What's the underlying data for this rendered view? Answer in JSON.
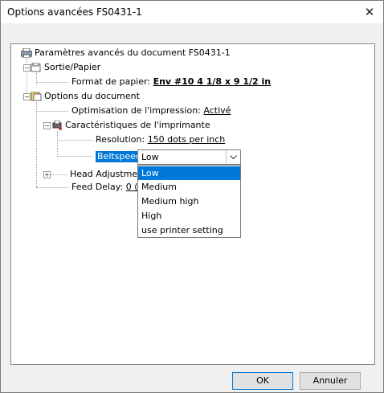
{
  "window": {
    "title": "Options avancées FS0431-1",
    "close_glyph": "✕"
  },
  "tree": {
    "root_label": "Paramètres avancés du document FS0431-1",
    "output": {
      "label": "Sortie/Papier",
      "paper_format_label": "Format de papier:",
      "paper_format_value": "Env #10 4 1/8 x 9 1/2 in"
    },
    "document": {
      "label": "Options du document",
      "print_opt_label": "Optimisation de l'impression:",
      "print_opt_value": "Activé",
      "printer": {
        "label": "Caractéristiques de l'imprimante",
        "resolution_label": "Resolution:",
        "resolution_value": "150 dots per inch",
        "beltspeed_label": "Beltspeed:",
        "beltspeed_value": "Low"
      },
      "head_adjust_label": "Head Adjustme",
      "feed_delay_label": "Feed Delay:",
      "feed_delay_value": "0 ("
    }
  },
  "dropdown": {
    "options": [
      "Low",
      "Medium",
      "Medium high",
      "High",
      "use printer setting"
    ],
    "selected_index": 0
  },
  "buttons": {
    "ok": "OK",
    "cancel": "Annuler"
  },
  "colors": {
    "accent": "#0078d7"
  }
}
